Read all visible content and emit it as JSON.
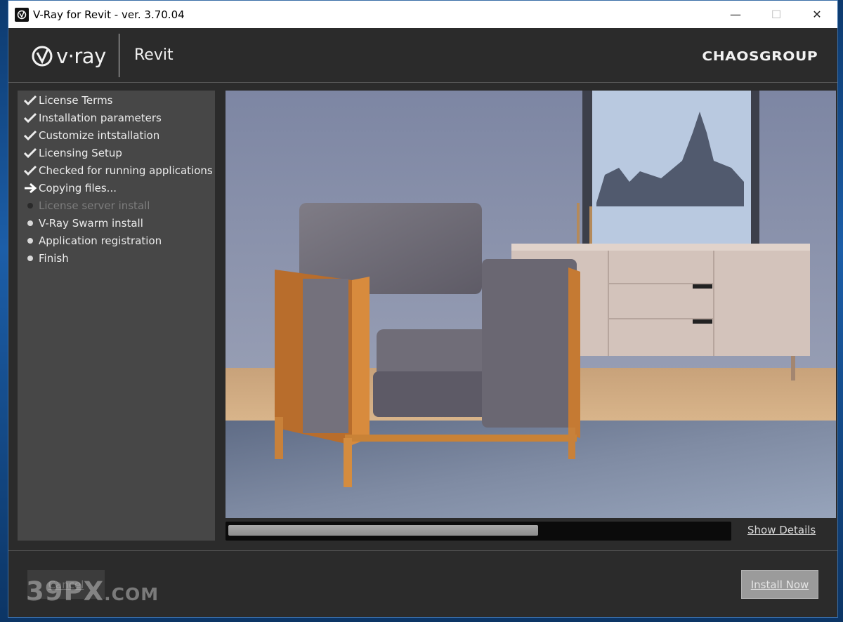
{
  "window": {
    "title": "V-Ray for Revit - ver. 3.70.04",
    "controls": {
      "minimize": "—",
      "maximize": "☐",
      "close": "✕"
    }
  },
  "header": {
    "product_logo": "v·ray",
    "product_name": "Revit",
    "company_logo": "CHAOSGROUP"
  },
  "steps": [
    {
      "label": "License Terms",
      "state": "done"
    },
    {
      "label": "Installation parameters",
      "state": "done"
    },
    {
      "label": "Customize intstallation",
      "state": "done"
    },
    {
      "label": "Licensing Setup",
      "state": "done"
    },
    {
      "label": "Checked for running applications",
      "state": "done"
    },
    {
      "label": "Copying files...",
      "state": "current"
    },
    {
      "label": "License server install",
      "state": "disabled"
    },
    {
      "label": "V-Ray Swarm install",
      "state": "pending"
    },
    {
      "label": "Application registration",
      "state": "pending"
    },
    {
      "label": "Finish",
      "state": "pending"
    }
  ],
  "progress": {
    "fraction": 0.62
  },
  "show_details": "Show Details",
  "buttons": {
    "cancel": "Cancel",
    "install": "Install Now"
  },
  "watermark": {
    "main": "39PX",
    "suffix": ".COM"
  }
}
